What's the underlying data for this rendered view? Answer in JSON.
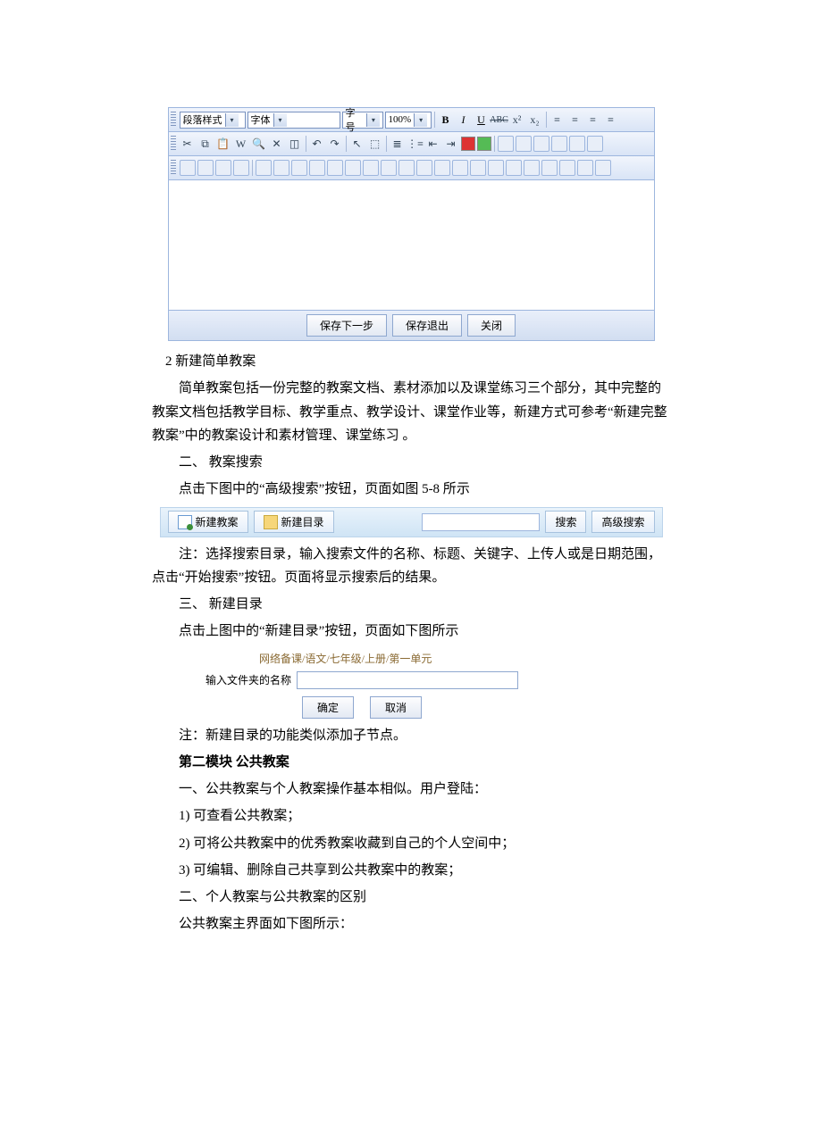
{
  "editor": {
    "selects": {
      "style": "段落样式",
      "font": "字体",
      "size": "字号",
      "zoom": "100%"
    },
    "fmt": {
      "b": "B",
      "i": "I",
      "u": "U",
      "abc": "ABC"
    },
    "footer": {
      "save_next": "保存下一步",
      "save_exit": "保存退出",
      "close": "关闭"
    }
  },
  "text": {
    "l1": "2  新建简单教案",
    "l2": "简单教案包括一份完整的教案文档、素材添加以及课堂练习三个部分，其中完整的教案文档包括教学目标、教学重点、教学设计、课堂作业等，新建方式可参考“新建完整教案”中的教案设计和素材管理、课堂练习 。",
    "l3": "二、 教案搜索",
    "l4": "点击下图中的“高级搜索”按钮，页面如图 5-8 所示",
    "l5": "注：选择搜索目录，输入搜索文件的名称、标题、关键字、上传人或是日期范围，点击“开始搜索”按钮。页面将显示搜索后的结果。",
    "l6": "三、 新建目录",
    "l7": "点击上图中的“新建目录”按钮，页面如下图所示",
    "l8": "注：新建目录的功能类似添加子节点。",
    "l9": "第二模块  公共教案",
    "l10": "一、公共教案与个人教案操作基本相似。用户登陆：",
    "l11": "1)    可查看公共教案；",
    "l12": "2)    可将公共教案中的优秀教案收藏到自己的个人空间中；",
    "l13": "3)    可编辑、删除自己共享到公共教案中的教案；",
    "l14": "二、个人教案与公共教案的区别",
    "l15": "公共教案主界面如下图所示："
  },
  "searchbar": {
    "new_plan": "新建教案",
    "new_dir": "新建目录",
    "search": "搜索",
    "adv": "高级搜索"
  },
  "newdir": {
    "crumb": "网络备课/语文/七年级/上册/第一单元",
    "label": "输入文件夹的名称",
    "ok": "确定",
    "cancel": "取消"
  }
}
